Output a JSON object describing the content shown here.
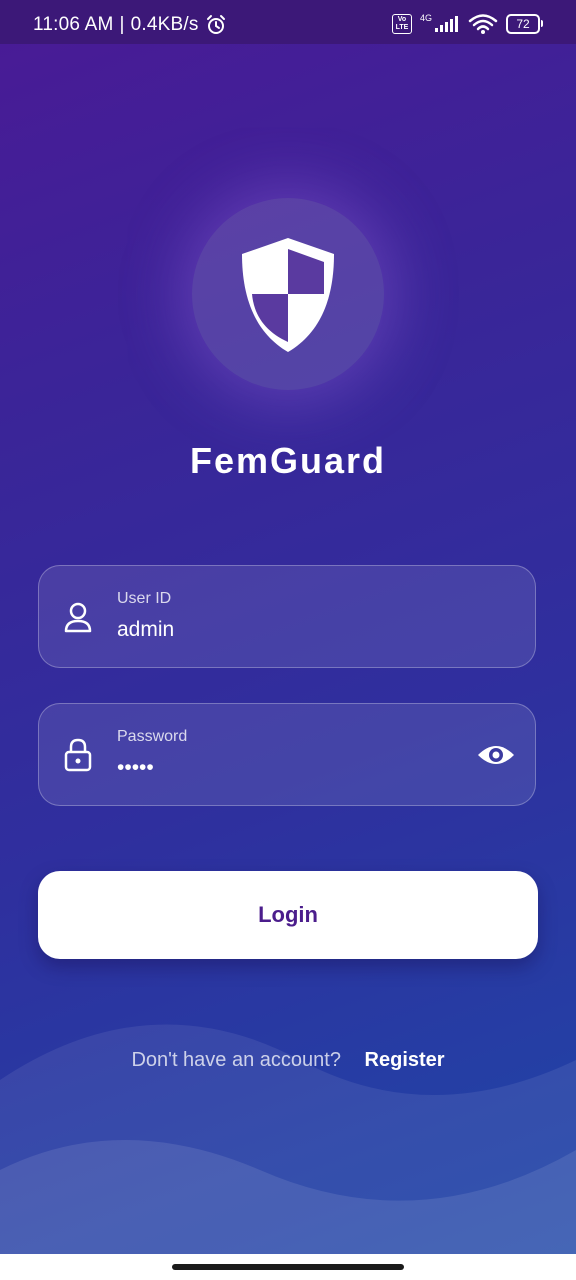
{
  "status_bar": {
    "time": "11:06 AM",
    "separator": "|",
    "network_speed": "0.4KB/s",
    "alarm_icon": "alarm-icon",
    "volte_label": "Vo LTE",
    "network_type": "4G",
    "battery_level": "72"
  },
  "app": {
    "logo_icon": "shield-icon",
    "title": "FemGuard"
  },
  "form": {
    "user_id": {
      "label": "User ID",
      "value": "admin",
      "icon": "user-icon"
    },
    "password": {
      "label": "Password",
      "value": "•••••",
      "icon": "lock-icon",
      "toggle_icon": "eye-icon"
    },
    "login_label": "Login"
  },
  "register": {
    "prompt": "Don't have an account?",
    "link_label": "Register"
  },
  "colors": {
    "gradient_top": "#4a1a96",
    "gradient_bottom": "#1f47a8",
    "button_text": "#4b1d8c",
    "button_bg": "#ffffff"
  }
}
